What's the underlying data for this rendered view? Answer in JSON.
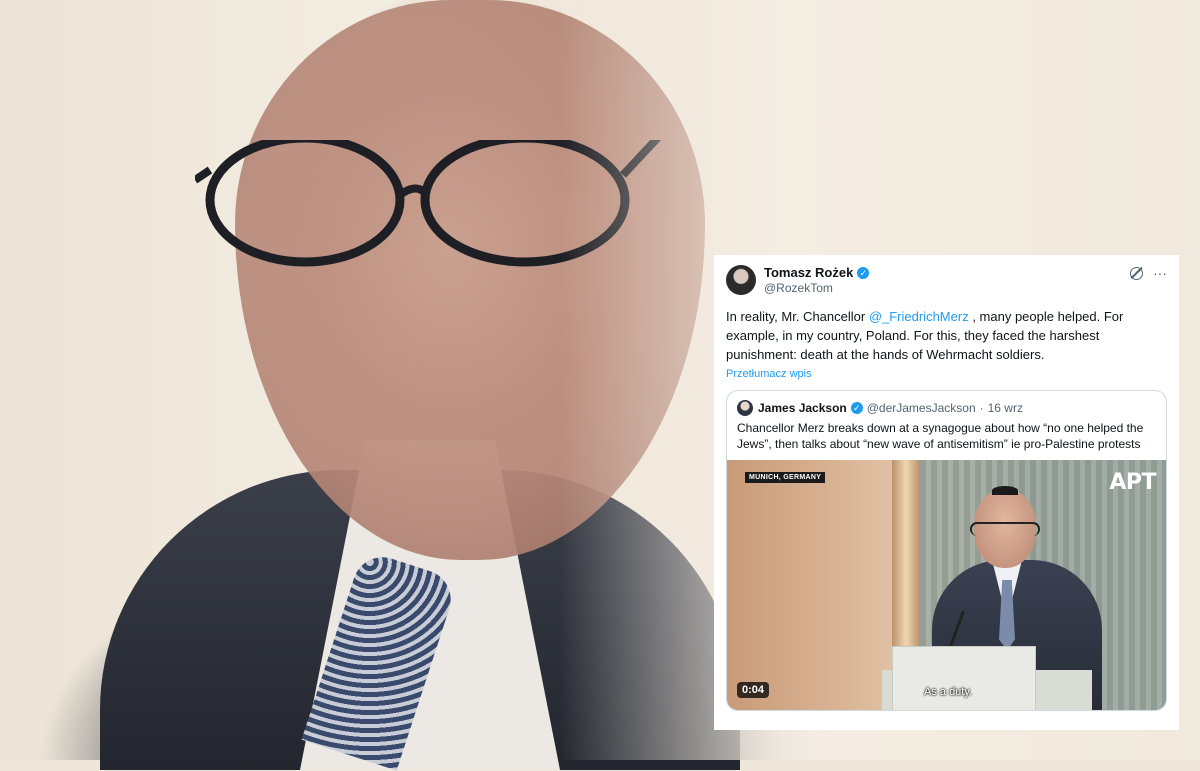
{
  "tweet": {
    "author_name": "Tomasz Rożek",
    "author_handle": "@RozekTom",
    "body_before": "In reality, Mr. Chancellor ",
    "mention": "@_FriedrichMerz",
    "body_after": " , many people helped. For example, in my country, Poland. For this, they faced the harshest punishment: death at the hands of Wehrmacht soldiers.",
    "translate_label": "Przetłumacz wpis",
    "more_label": "···",
    "grok_icon": "grok-icon",
    "verified_icon": "verified-badge-icon"
  },
  "quote": {
    "author_name": "James Jackson",
    "author_handle": "@derJamesJackson",
    "separator": "·",
    "date": "16 wrz",
    "text": "Chancellor Merz breaks down at a synagogue about how “no one helped the Jews”, then talks about “new wave of antisemitism” ie pro-Palestine protests",
    "video": {
      "location_tag": "MUNICH, GERMANY",
      "brand": "APT",
      "subtitle": "As a duty.",
      "timestamp": "0:04"
    }
  },
  "colors": {
    "link": "#1d9bf0",
    "text": "#0f1419",
    "muted": "#536471",
    "border": "#cfd9de"
  }
}
